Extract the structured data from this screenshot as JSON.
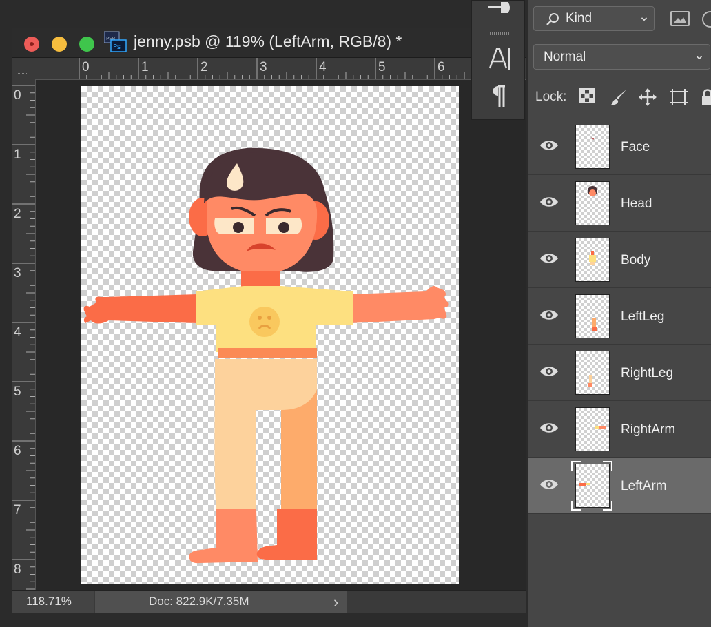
{
  "document": {
    "title": "jenny.psb @ 119% (LeftArm, RGB/8) *",
    "zoom": "118.71%",
    "doc_info": "Doc: 822.9K/7.35M",
    "ruler_h": [
      "0",
      "1",
      "2",
      "3",
      "4",
      "5",
      "6"
    ],
    "ruler_v": [
      "0",
      "1",
      "2",
      "3",
      "4",
      "5",
      "6",
      "7",
      "8"
    ]
  },
  "layers_panel": {
    "filter_kind": "Kind",
    "blend_mode": "Normal",
    "lock_label": "Lock:",
    "layers": [
      {
        "name": "Face",
        "visible": true,
        "selected": false
      },
      {
        "name": "Head",
        "visible": true,
        "selected": false
      },
      {
        "name": "Body",
        "visible": true,
        "selected": false
      },
      {
        "name": "LeftLeg",
        "visible": true,
        "selected": false
      },
      {
        "name": "RightLeg",
        "visible": true,
        "selected": false
      },
      {
        "name": "RightArm",
        "visible": true,
        "selected": false
      },
      {
        "name": "LeftArm",
        "visible": true,
        "selected": true
      }
    ]
  },
  "colors": {
    "skin": "#ff8a65",
    "skin_dark": "#fb6c47",
    "hair": "#4a3338",
    "shirt": "#fde080",
    "pants_light": "#fdd29c",
    "pants_dark": "#fdab6b",
    "selected_layer": "#6a6a6a"
  }
}
